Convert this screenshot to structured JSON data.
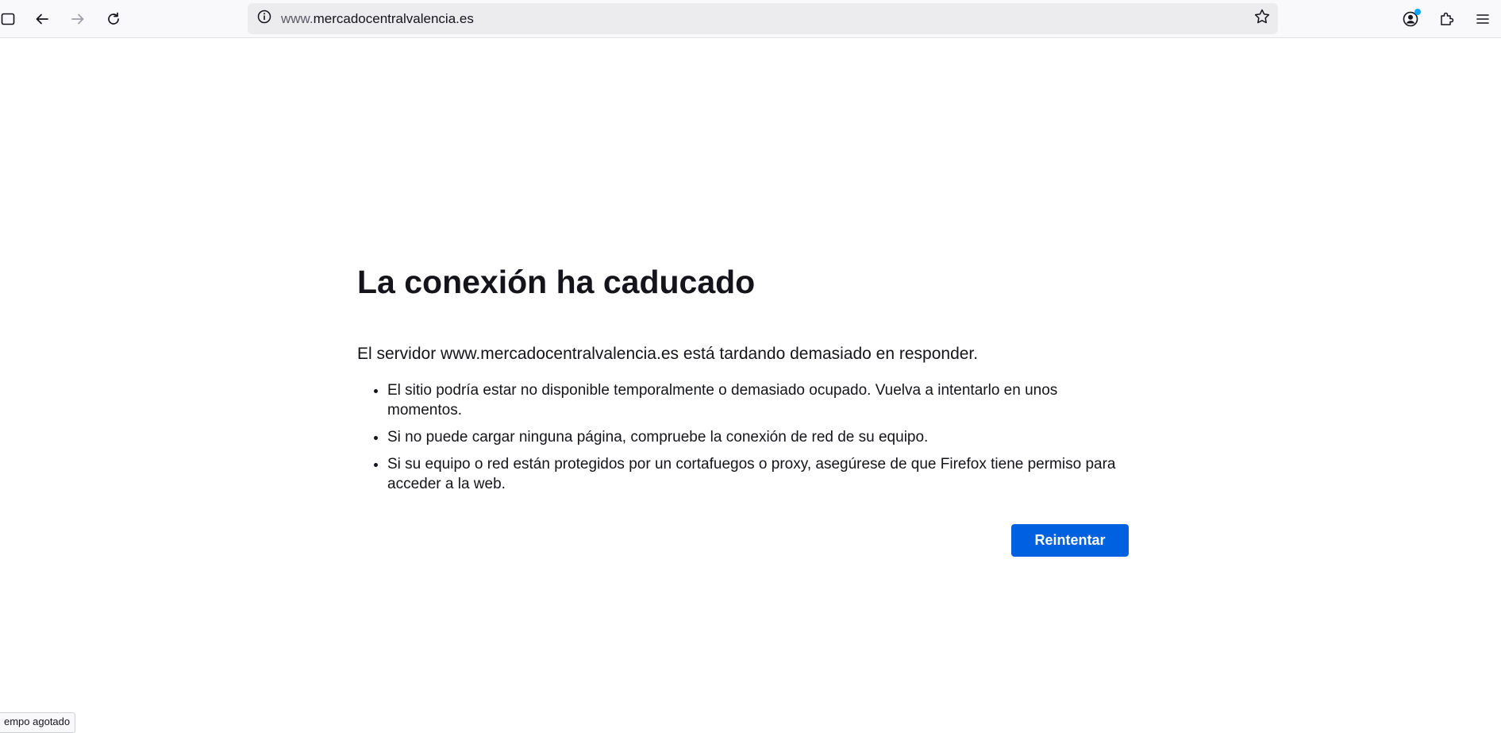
{
  "browser": {
    "url_prefix": "www.",
    "url_domain": "mercadocentralvalencia.es",
    "status_text": "empo agotado",
    "icons": {
      "sidebar": "sidebar-toggle-icon",
      "back": "back-arrow-icon",
      "forward": "forward-arrow-icon",
      "reload": "reload-icon",
      "info": "info-icon",
      "bookmark": "star-icon",
      "account": "account-icon",
      "extensions": "puzzle-icon",
      "menu": "hamburger-menu-icon"
    },
    "colors": {
      "accent": "#0061e0",
      "badge": "#0aa5ff",
      "toolbar_bg": "#f9f9fb",
      "urlbar_bg": "#ececef"
    }
  },
  "error_page": {
    "title": "La conexión ha caducado",
    "description": "El servidor www.mercadocentralvalencia.es está tardando demasiado en responder.",
    "bullets": [
      "El sitio podría estar no disponible temporalmente o demasiado ocupado. Vuelva a intentarlo en unos momentos.",
      "Si no puede cargar ninguna página, compruebe la conexión de red de su equipo.",
      "Si su equipo o red están protegidos por un cortafuegos o proxy, asegúrese de que Firefox tiene permiso para acceder a la web."
    ],
    "retry_label": "Reintentar"
  }
}
